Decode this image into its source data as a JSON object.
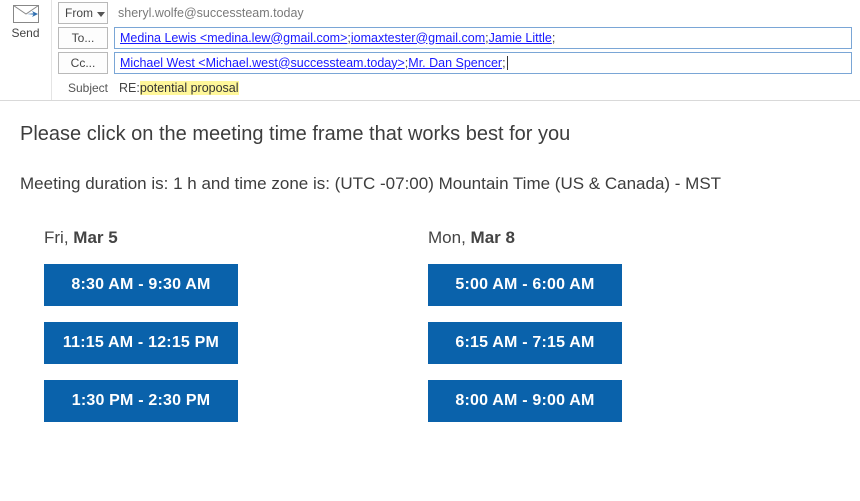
{
  "labels": {
    "send": "Send",
    "from": "From",
    "to": "To...",
    "cc": "Cc...",
    "subject": "Subject"
  },
  "from_value": "sheryl.wolfe@successteam.today",
  "to": [
    "Medina Lewis <medina.lew@gmail.com>",
    "iomaxtester@gmail.com",
    "Jamie Little"
  ],
  "cc": [
    "Michael West <Michael.west@successteam.today>",
    "Mr. Dan Spencer"
  ],
  "subject_prefix": "RE: ",
  "subject_highlight": "potential proposal",
  "body": {
    "prompt": "Please click on the meeting time frame that works best for you",
    "meta": "Meeting duration is: 1 h and time zone is: (UTC -07:00) Mountain Time (US & Canada) - MST",
    "days": [
      {
        "weekday": "Fri, ",
        "date": "Mar 5",
        "slots": [
          "8:30 AM - 9:30 AM",
          "11:15 AM - 12:15 PM",
          "1:30 PM - 2:30 PM"
        ]
      },
      {
        "weekday": "Mon, ",
        "date": "Mar 8",
        "slots": [
          "5:00 AM - 6:00 AM",
          "6:15 AM - 7:15 AM",
          "8:00 AM - 9:00 AM"
        ]
      }
    ]
  }
}
